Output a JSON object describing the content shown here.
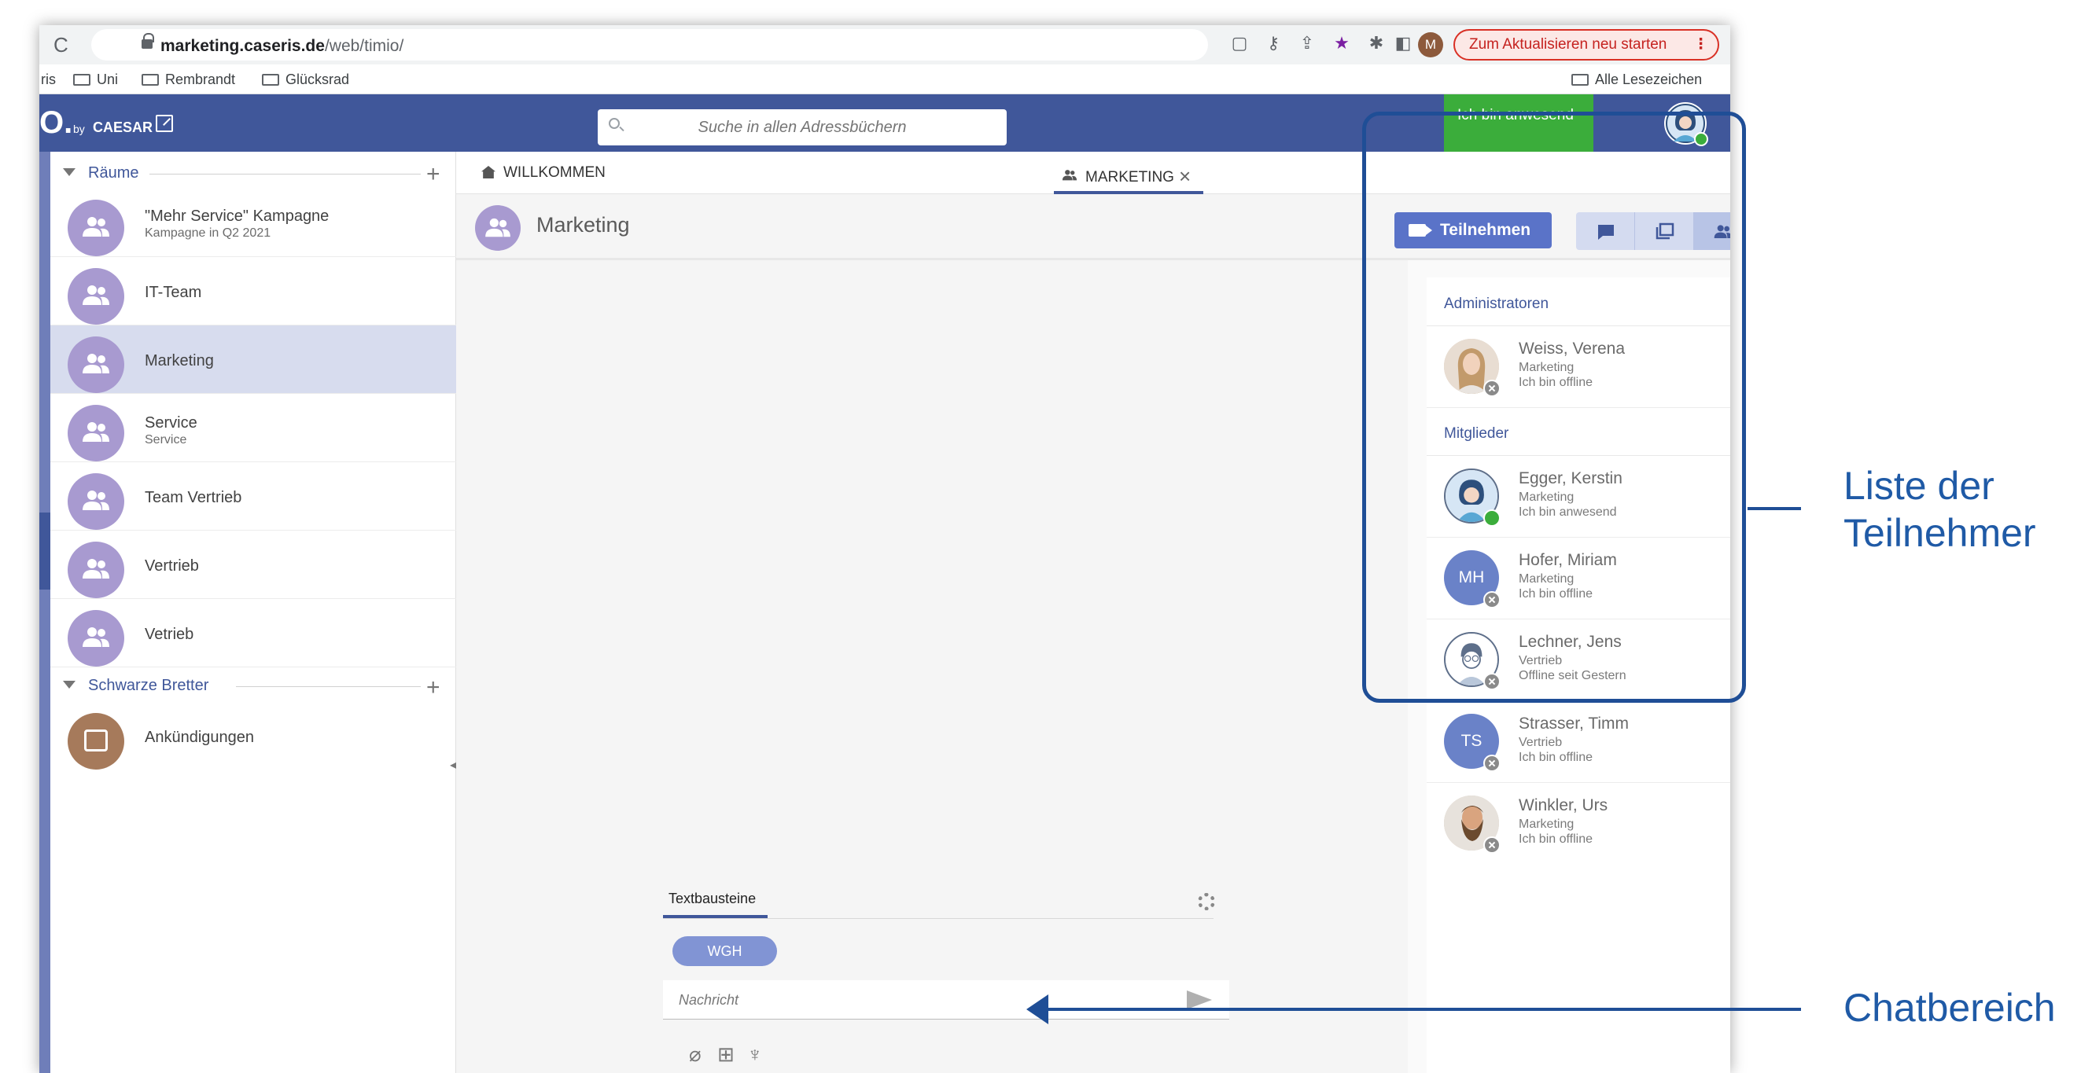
{
  "browser": {
    "url_host": "marketing.caseris.de",
    "url_path": "/web/timio/",
    "profile_initial": "M",
    "update_button": "Zum Aktualisieren neu starten",
    "bookmarks": [
      "ris",
      "Uni",
      "Rembrandt",
      "Glücksrad"
    ],
    "all_bookmarks": "Alle Lesezeichen"
  },
  "app": {
    "logo": "O.",
    "logo_by": "by",
    "logo_brand": "CAESAR",
    "search_placeholder": "Suche in allen Adressbüchern",
    "presence_status": "Ich bin anwesend"
  },
  "sidebar": {
    "rooms_header": "Räume",
    "rooms": [
      {
        "name": "\"Mehr Service\" Kampagne",
        "sub": "Kampagne in Q2 2021"
      },
      {
        "name": "IT-Team",
        "sub": ""
      },
      {
        "name": "Marketing",
        "sub": ""
      },
      {
        "name": "Service",
        "sub": "Service"
      },
      {
        "name": "Team Vertrieb",
        "sub": ""
      },
      {
        "name": "Vertrieb",
        "sub": ""
      },
      {
        "name": "Vetrieb",
        "sub": ""
      }
    ],
    "boards_header": "Schwarze Bretter",
    "boards": [
      {
        "name": "Ankündigungen"
      }
    ]
  },
  "tabs": [
    {
      "label": "WILLKOMMEN"
    },
    {
      "label": "MARKETING"
    }
  ],
  "room_header": {
    "title": "Marketing",
    "join_label": "Teilnehmen"
  },
  "chat": {
    "snippets_tab": "Textbausteine",
    "chip": "WGH",
    "message_placeholder": "Nachricht"
  },
  "participants": {
    "admins_header": "Administratoren",
    "members_header": "Mitglieder",
    "admins": [
      {
        "name": "Weiss, Verena",
        "dept": "Marketing",
        "state": "Ich bin offline"
      }
    ],
    "members": [
      {
        "name": "Egger, Kerstin",
        "dept": "Marketing",
        "state": "Ich bin anwesend"
      },
      {
        "name": "Hofer, Miriam",
        "dept": "Marketing",
        "state": "Ich bin offline",
        "initials": "MH"
      },
      {
        "name": "Lechner, Jens",
        "dept": "Vertrieb",
        "state": "Offline seit Gestern"
      },
      {
        "name": "Strasser, Timm",
        "dept": "Vertrieb",
        "state": "Ich bin offline",
        "initials": "TS"
      },
      {
        "name": "Winkler, Urs",
        "dept": "Marketing",
        "state": "Ich bin offline"
      }
    ]
  },
  "annotations": {
    "participants_label_line1": "Liste der",
    "participants_label_line2": "Teilnehmer",
    "chat_label": "Chatbereich"
  },
  "colors": {
    "header": "#40579a",
    "presence": "#3bad3b",
    "annotation": "#1f4e96"
  }
}
